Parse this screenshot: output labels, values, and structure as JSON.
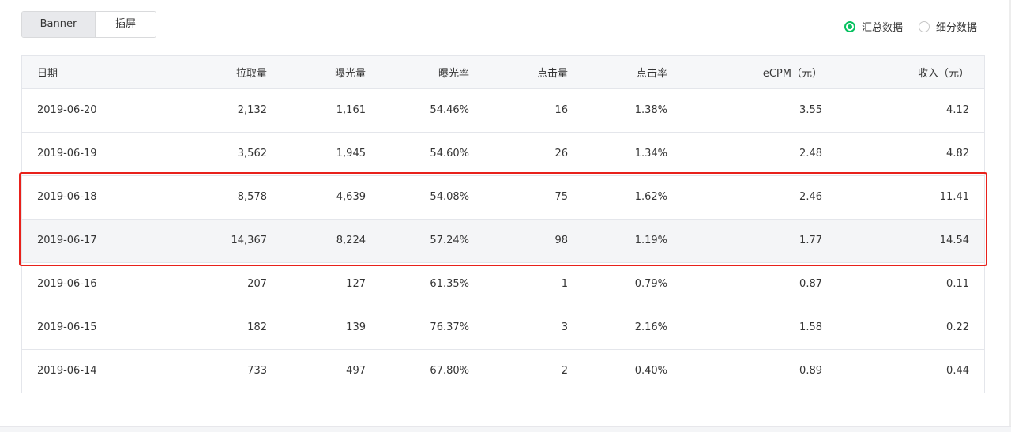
{
  "tabs": [
    {
      "label": "Banner",
      "active": true
    },
    {
      "label": "插屏",
      "active": false
    }
  ],
  "view_mode": {
    "options": [
      {
        "label": "汇总数据",
        "checked": true
      },
      {
        "label": "细分数据",
        "checked": false
      }
    ]
  },
  "colors": {
    "accent": "#07c160",
    "annotation": "#e8211b",
    "header_bg": "#f6f7f9",
    "border": "#e4e6eb"
  },
  "table": {
    "headers": [
      "日期",
      "拉取量",
      "曝光量",
      "曝光率",
      "点击量",
      "点击率",
      "eCPM（元）",
      "收入（元）"
    ],
    "rows": [
      [
        "2019-06-20",
        "2,132",
        "1,161",
        "54.46%",
        "16",
        "1.38%",
        "3.55",
        "4.12"
      ],
      [
        "2019-06-19",
        "3,562",
        "1,945",
        "54.60%",
        "26",
        "1.34%",
        "2.48",
        "4.82"
      ],
      [
        "2019-06-18",
        "8,578",
        "4,639",
        "54.08%",
        "75",
        "1.62%",
        "2.46",
        "11.41"
      ],
      [
        "2019-06-17",
        "14,367",
        "8,224",
        "57.24%",
        "98",
        "1.19%",
        "1.77",
        "14.54"
      ],
      [
        "2019-06-16",
        "207",
        "127",
        "61.35%",
        "1",
        "0.79%",
        "0.87",
        "0.11"
      ],
      [
        "2019-06-15",
        "182",
        "139",
        "76.37%",
        "3",
        "2.16%",
        "1.58",
        "0.22"
      ],
      [
        "2019-06-14",
        "733",
        "497",
        "67.80%",
        "2",
        "0.40%",
        "0.89",
        "0.44"
      ]
    ]
  }
}
